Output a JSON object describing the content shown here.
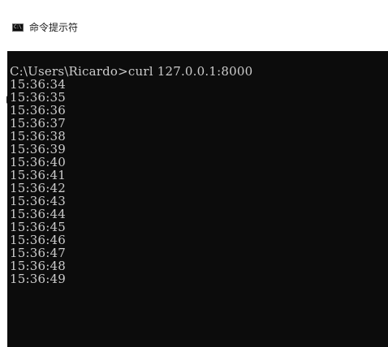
{
  "window": {
    "title": "命令提示符",
    "icon": "command-prompt-icon",
    "icon_glyph": "C:\\"
  },
  "console": {
    "lines": [
      "C:\\Users\\Ricardo>curl 127.0.0.1:8000",
      "15:36:34",
      "15:36:35",
      "15:36:36",
      "15:36:37",
      "15:36:38",
      "15:36:39",
      "15:36:40",
      "15:36:41",
      "15:36:42",
      "15:36:43",
      "15:36:44",
      "15:36:45",
      "15:36:46",
      "15:36:47",
      "15:36:48",
      "15:36:49"
    ],
    "text_color": "#cccccc",
    "background_color": "#0c0c0c"
  }
}
